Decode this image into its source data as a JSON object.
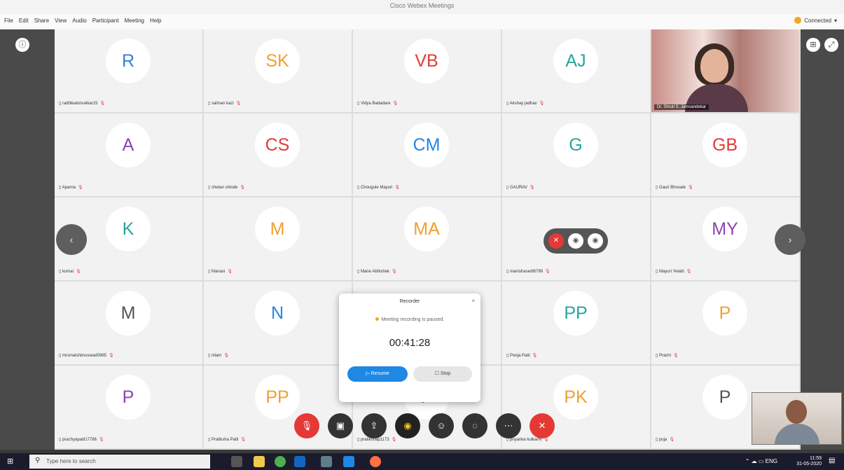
{
  "window": {
    "title": "Cisco Webex Meetings"
  },
  "menu": [
    "File",
    "Edit",
    "Share",
    "View",
    "Audio",
    "Participant",
    "Meeting",
    "Help"
  ],
  "status": {
    "label": "Connected"
  },
  "participants": [
    {
      "initials": "R",
      "name": "radhikalonvalkar15",
      "color": "#3a7fd5"
    },
    {
      "initials": "SK",
      "name": "salman kazi",
      "color": "#f0a030"
    },
    {
      "initials": "VB",
      "name": "Vidya Badadare",
      "color": "#e53935"
    },
    {
      "initials": "AJ",
      "name": "Akshay jadhav",
      "color": "#26a69a"
    },
    {
      "initials": "",
      "name": "Dr. Shruti S. Jamsandekar",
      "color": "#333"
    },
    {
      "initials": "A",
      "name": "Aparna",
      "color": "#8e44ad"
    },
    {
      "initials": "CS",
      "name": "chetan shinde",
      "color": "#e53935"
    },
    {
      "initials": "CM",
      "name": "Chougule Mayuri",
      "color": "#1e88e5"
    },
    {
      "initials": "G",
      "name": "GAURAV",
      "color": "#26a69a"
    },
    {
      "initials": "GB",
      "name": "Gauri Bhosale",
      "color": "#e53935"
    },
    {
      "initials": "K",
      "name": "komal",
      "color": "#26a69a"
    },
    {
      "initials": "M",
      "name": "Manasi",
      "color": "#f0a030"
    },
    {
      "initials": "MA",
      "name": "Mane Abhishek",
      "color": "#f0a030"
    },
    {
      "initials": "",
      "name": "manishasedl6799",
      "color": "#333"
    },
    {
      "initials": "MY",
      "name": "Mayuri Yelatti",
      "color": "#8e44ad"
    },
    {
      "initials": "M",
      "name": "mrsmalshimoswad0965",
      "color": "#555"
    },
    {
      "initials": "N",
      "name": "nilam",
      "color": "#1e88e5"
    },
    {
      "initials": "",
      "name": "",
      "color": "#333"
    },
    {
      "initials": "PP",
      "name": "Pooja Patil",
      "color": "#26a69a"
    },
    {
      "initials": "P",
      "name": "Prachi",
      "color": "#f0a030"
    },
    {
      "initials": "P",
      "name": "prachyapatil17786",
      "color": "#8e44ad"
    },
    {
      "initials": "PP",
      "name": "Pratiksha Patil",
      "color": "#f0a030"
    },
    {
      "initials": "P",
      "name": "pratikshap1173",
      "color": "#e53935"
    },
    {
      "initials": "PK",
      "name": "priyanka kulkarni",
      "color": "#f0a030"
    },
    {
      "initials": "P",
      "name": "puja",
      "color": "#555"
    }
  ],
  "recorder": {
    "title": "Recorder",
    "status": "Meeting recording is paused.",
    "time": "00:41:28",
    "resume_label": "Resume",
    "stop_label": "Stop"
  },
  "taskbar": {
    "search_placeholder": "Type here to search",
    "lang": "ENG",
    "time": "11:59",
    "date": "31-05-2020"
  }
}
